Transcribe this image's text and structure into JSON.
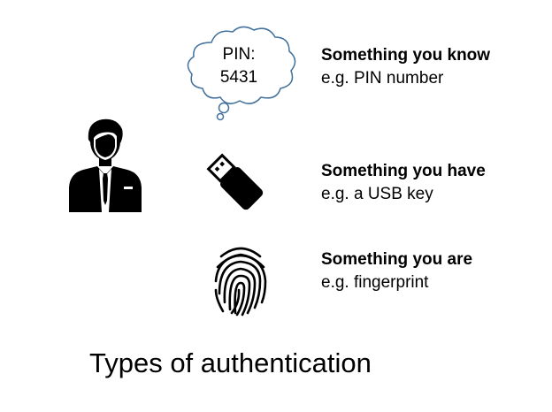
{
  "pin_bubble": {
    "label": "PIN:",
    "value": "5431"
  },
  "factors": [
    {
      "title": "Something you know",
      "example": "e.g. PIN number",
      "icon": "thought-cloud-icon"
    },
    {
      "title": "Something you have",
      "example": "e.g. a USB key",
      "icon": "usb-key-icon"
    },
    {
      "title": "Something you are",
      "example": "e.g. fingerprint",
      "icon": "fingerprint-icon"
    }
  ],
  "person_icon": "businessman-icon",
  "caption": "Types of authentication"
}
